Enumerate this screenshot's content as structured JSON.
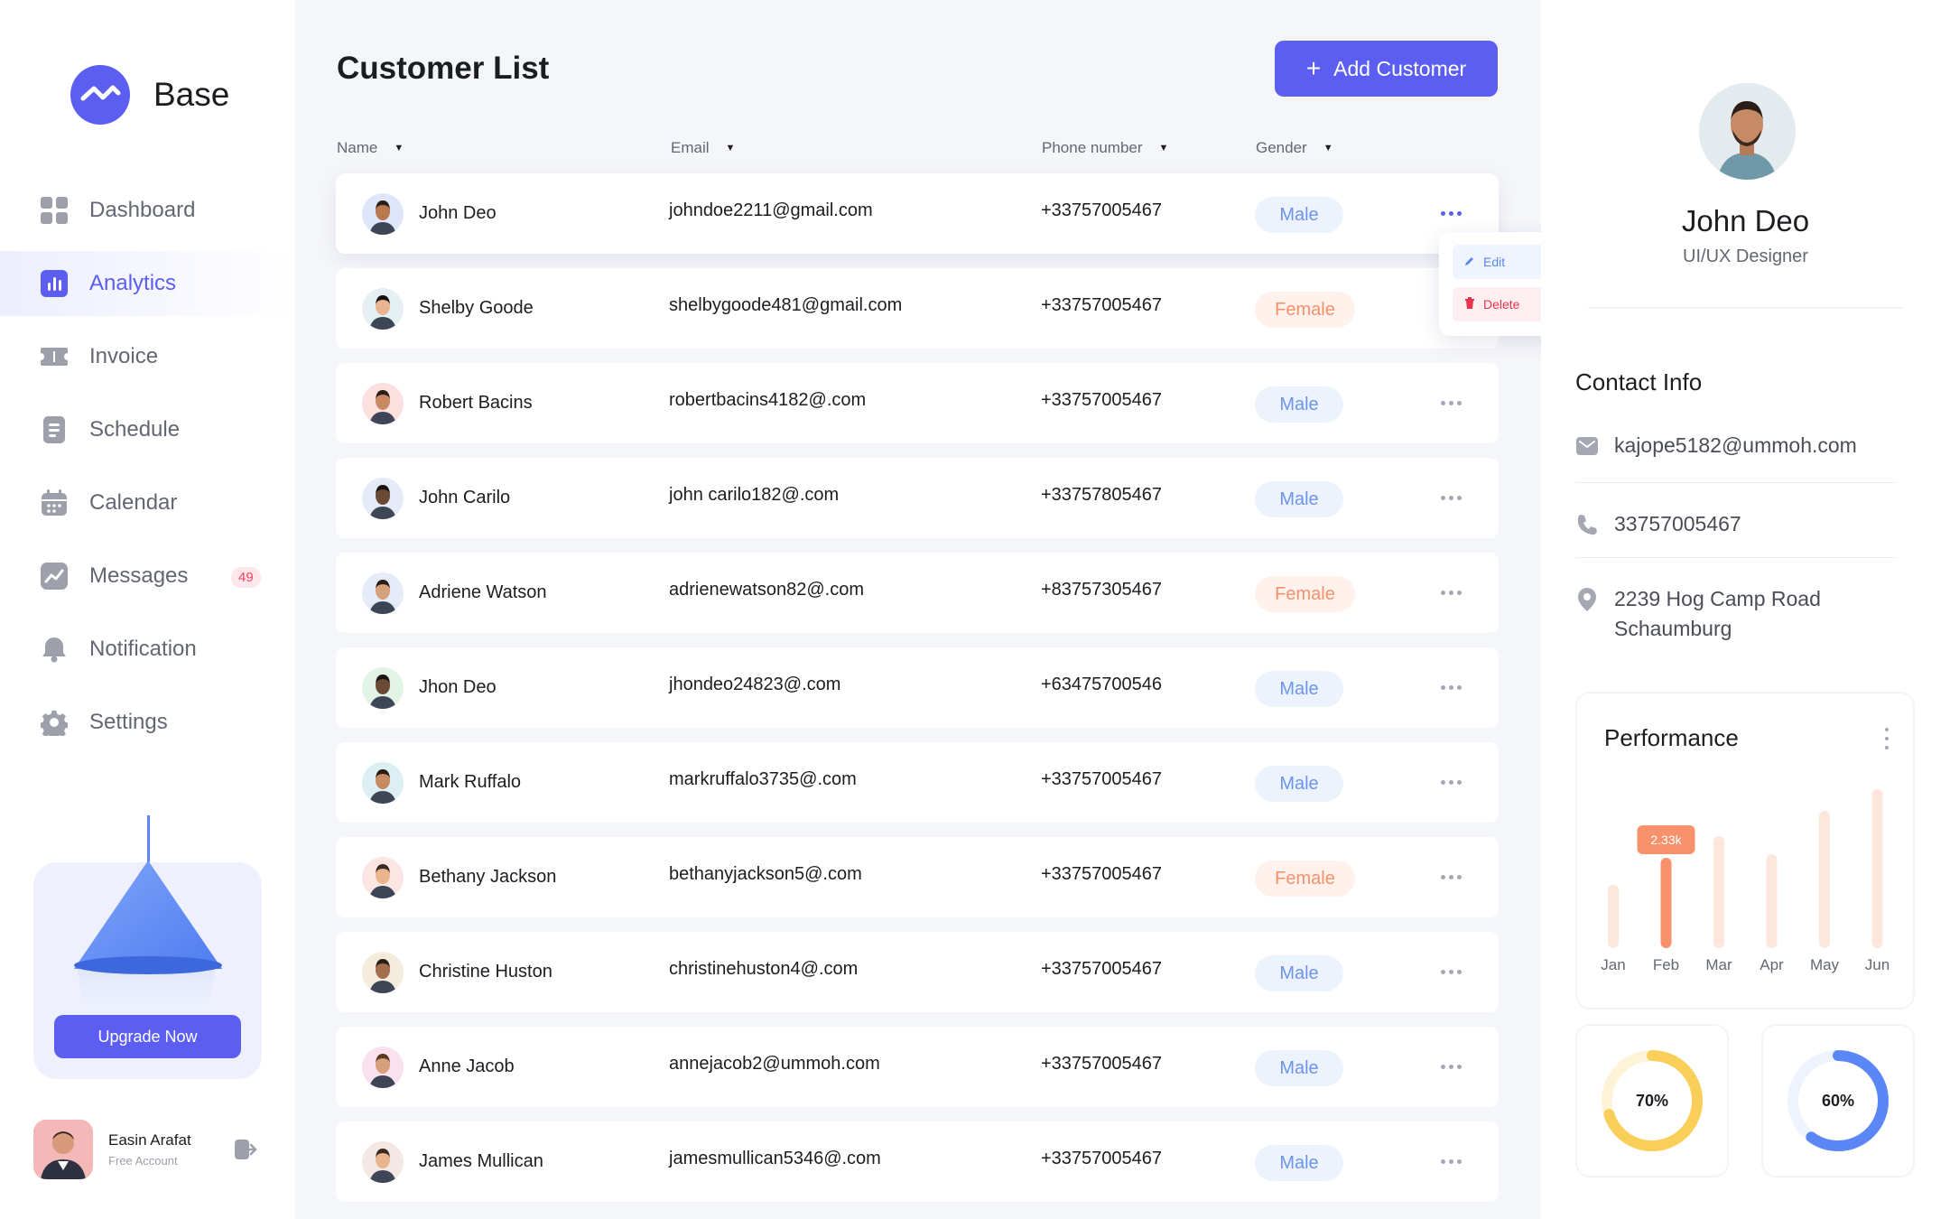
{
  "brand": {
    "name": "Base"
  },
  "nav": [
    {
      "label": "Dashboard",
      "icon": "dashboard-icon"
    },
    {
      "label": "Analytics",
      "icon": "analytics-icon",
      "active": true
    },
    {
      "label": "Invoice",
      "icon": "invoice-icon"
    },
    {
      "label": "Schedule",
      "icon": "schedule-icon"
    },
    {
      "label": "Calendar",
      "icon": "calendar-icon"
    },
    {
      "label": "Messages",
      "icon": "messages-icon",
      "badge": "49"
    },
    {
      "label": "Notification",
      "icon": "notification-icon"
    },
    {
      "label": "Settings",
      "icon": "settings-icon"
    }
  ],
  "upgrade": {
    "button": "Upgrade Now"
  },
  "profile": {
    "name": "Easin Arafat",
    "plan": "Free Account"
  },
  "main": {
    "title": "Customer List",
    "add_button": "Add Customer",
    "columns": [
      "Name",
      "Email",
      "Phone number",
      "Gender"
    ],
    "rows": [
      {
        "name": "John Deo",
        "email": "johndoe2211@gmail.com",
        "phone": "+33757005467",
        "gender": "Male"
      },
      {
        "name": "Shelby Goode",
        "email": "shelbygoode481@gmail.com",
        "phone": "+33757005467",
        "gender": "Female"
      },
      {
        "name": "Robert Bacins",
        "email": "robertbacins4182@.com",
        "phone": "+33757005467",
        "gender": "Male"
      },
      {
        "name": "John Carilo",
        "email": "john carilo182@.com",
        "phone": "+33757805467",
        "gender": "Male"
      },
      {
        "name": "Adriene Watson",
        "email": "adrienewatson82@.com",
        "phone": "+83757305467",
        "gender": "Female"
      },
      {
        "name": "Jhon Deo",
        "email": "jhondeo24823@.com",
        "phone": "+63475700546",
        "gender": "Male"
      },
      {
        "name": "Mark Ruffalo",
        "email": "markruffalo3735@.com",
        "phone": "+33757005467",
        "gender": "Male"
      },
      {
        "name": "Bethany Jackson",
        "email": "bethanyjackson5@.com",
        "phone": "+33757005467",
        "gender": "Female"
      },
      {
        "name": "Christine Huston",
        "email": "christinehuston4@.com",
        "phone": "+33757005467",
        "gender": "Male"
      },
      {
        "name": "Anne Jacob",
        "email": "annejacob2@ummoh.com",
        "phone": "+33757005467",
        "gender": "Male"
      },
      {
        "name": "James Mullican",
        "email": "jamesmullican5346@.com",
        "phone": "+33757005467",
        "gender": "Male"
      }
    ],
    "row_menu": {
      "edit": "Edit",
      "delete": "Delete"
    }
  },
  "details": {
    "name": "John Deo",
    "role": "UI/UX Designer",
    "contact_title": "Contact Info",
    "email": "kajope5182@ummoh.com",
    "phone": "33757005467",
    "address_line1": "2239  Hog Camp Road",
    "address_line2": "Schaumburg"
  },
  "performance": {
    "title": "Performance",
    "tooltip": "2.33k"
  },
  "chart_data": {
    "type": "bar",
    "title": "Performance",
    "categories": [
      "Jan",
      "Feb",
      "Mar",
      "Apr",
      "May",
      "Jun"
    ],
    "values": [
      0.35,
      0.5,
      0.62,
      0.52,
      0.76,
      0.88
    ],
    "highlighted_index": 1,
    "highlight_label": "2.33k",
    "ylim": [
      0,
      1
    ]
  },
  "donuts": [
    {
      "label": "70%",
      "value": 70,
      "color": "#f9cf5a"
    },
    {
      "label": "60%",
      "value": 60,
      "color": "#5b86f5"
    }
  ],
  "colors": {
    "accent": "#5b5ef0",
    "bar_active": "#f7916b",
    "bar_inactive": "#fde6dc",
    "male": "#6c94ec",
    "female": "#f7916b"
  }
}
